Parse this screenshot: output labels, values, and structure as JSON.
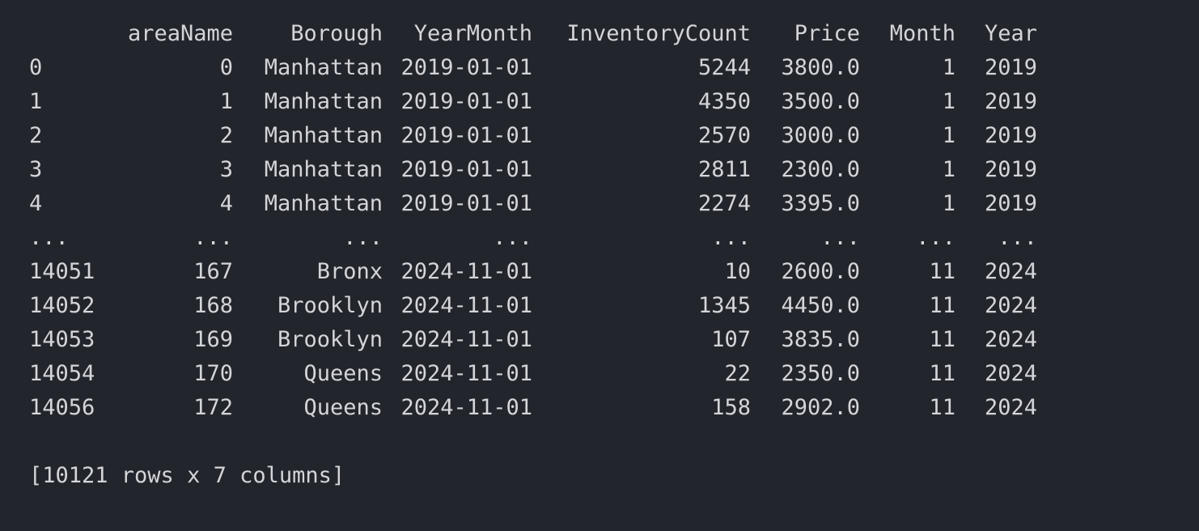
{
  "dataframe": {
    "columns": [
      "areaName",
      "Borough",
      "YearMonth",
      "InventoryCount",
      "Price",
      "Month",
      "Year"
    ],
    "rows": [
      {
        "index": "0",
        "cells": [
          "0",
          "Manhattan",
          "2019-01-01",
          "5244",
          "3800.0",
          "1",
          "2019"
        ]
      },
      {
        "index": "1",
        "cells": [
          "1",
          "Manhattan",
          "2019-01-01",
          "4350",
          "3500.0",
          "1",
          "2019"
        ]
      },
      {
        "index": "2",
        "cells": [
          "2",
          "Manhattan",
          "2019-01-01",
          "2570",
          "3000.0",
          "1",
          "2019"
        ]
      },
      {
        "index": "3",
        "cells": [
          "3",
          "Manhattan",
          "2019-01-01",
          "2811",
          "2300.0",
          "1",
          "2019"
        ]
      },
      {
        "index": "4",
        "cells": [
          "4",
          "Manhattan",
          "2019-01-01",
          "2274",
          "3395.0",
          "1",
          "2019"
        ]
      },
      {
        "index": "...",
        "cells": [
          "...",
          "...",
          "...",
          "...",
          "...",
          "...",
          "..."
        ]
      },
      {
        "index": "14051",
        "cells": [
          "167",
          "Bronx",
          "2024-11-01",
          "10",
          "2600.0",
          "11",
          "2024"
        ]
      },
      {
        "index": "14052",
        "cells": [
          "168",
          "Brooklyn",
          "2024-11-01",
          "1345",
          "4450.0",
          "11",
          "2024"
        ]
      },
      {
        "index": "14053",
        "cells": [
          "169",
          "Brooklyn",
          "2024-11-01",
          "107",
          "3835.0",
          "11",
          "2024"
        ]
      },
      {
        "index": "14054",
        "cells": [
          "170",
          "Queens",
          "2024-11-01",
          "22",
          "2350.0",
          "11",
          "2024"
        ]
      },
      {
        "index": "14056",
        "cells": [
          "172",
          "Queens",
          "2024-11-01",
          "158",
          "2902.0",
          "11",
          "2024"
        ]
      }
    ],
    "summary": "[10121 rows x 7 columns]"
  },
  "theme": {
    "background": "#23252d",
    "text": "#d4d5d9"
  }
}
